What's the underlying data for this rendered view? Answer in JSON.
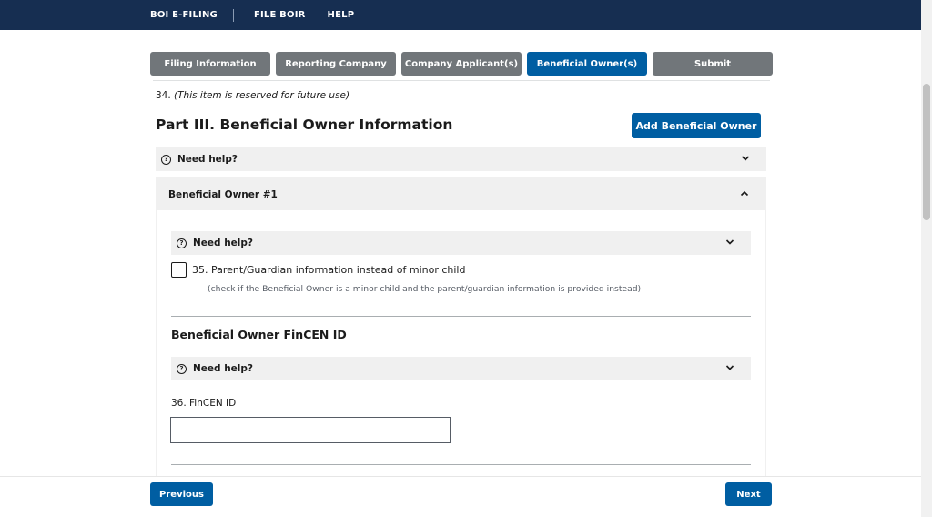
{
  "topnav": {
    "brand": "BOI E-FILING",
    "file_boir": "FILE BOIR",
    "help": "HELP"
  },
  "steps": [
    {
      "label": "Filing Information",
      "active": false
    },
    {
      "label": "Reporting Company",
      "active": false
    },
    {
      "label": "Company Applicant(s)",
      "active": false
    },
    {
      "label": "Beneficial Owner(s)",
      "active": true
    },
    {
      "label": "Submit",
      "active": false
    }
  ],
  "reserved": {
    "number": "34.",
    "text": "(This item is reserved for future use)"
  },
  "part": {
    "title": "Part III. Beneficial Owner Information",
    "add_button": "Add Beneficial Owner"
  },
  "help_label": "Need help?",
  "owner": {
    "header": "Beneficial Owner #1",
    "checkbox_label": "35. Parent/Guardian information instead of minor child",
    "checkbox_hint": "(check if the Beneficial Owner is a minor child and the parent/guardian information is provided instead)",
    "checkbox_checked": false,
    "fincen_section_title": "Beneficial Owner FinCEN ID",
    "fincen_field_label": "36. FinCEN ID",
    "fincen_field_value": ""
  },
  "footer": {
    "previous": "Previous",
    "next": "Next"
  },
  "colors": {
    "header_bg": "#162e51",
    "primary": "#005ea2",
    "step_inactive": "#71767a",
    "panel_bg": "#f0f0f0"
  },
  "icons": {
    "help": "question-circle-icon",
    "expand": "chevron-down-icon",
    "collapse": "chevron-up-icon"
  }
}
